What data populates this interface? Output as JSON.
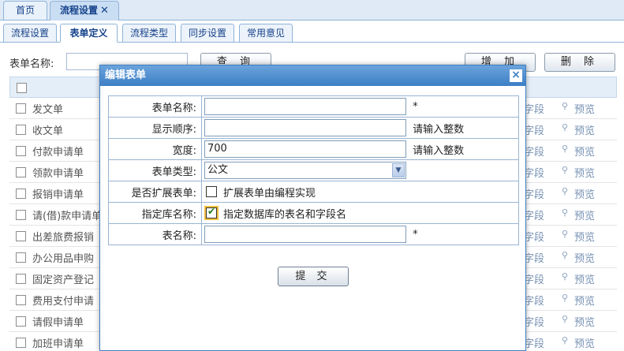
{
  "top_tabs": [
    {
      "label": "首页"
    },
    {
      "label": "流程设置",
      "close": "✕"
    }
  ],
  "sub_tabs": [
    {
      "label": "流程设置"
    },
    {
      "label": "表单定义"
    },
    {
      "label": "流程类型"
    },
    {
      "label": "同步设置"
    },
    {
      "label": "常用意见"
    }
  ],
  "toolbar": {
    "name_label": "表单名称:",
    "query_label": "查 询",
    "add_label": "增 加",
    "delete_label": "删 除"
  },
  "table": {
    "field_text": "字段",
    "preview_text": "预览",
    "preview_icon": "magnifier-icon",
    "rows": [
      {
        "name": "发文单"
      },
      {
        "name": "收文单"
      },
      {
        "name": "付款申请单"
      },
      {
        "name": "领款申请单"
      },
      {
        "name": "报销申请单"
      },
      {
        "name": "请(借)款申请单"
      },
      {
        "name": "出差旅费报销"
      },
      {
        "name": "办公用品申购"
      },
      {
        "name": "固定资产登记"
      },
      {
        "name": "费用支付申请"
      },
      {
        "name": "请假申请单"
      },
      {
        "name": "加班申请单"
      }
    ]
  },
  "dialog": {
    "title": "编辑表单",
    "close_icon": "close-icon",
    "fields": {
      "form_name_label": "表单名称:",
      "form_name_value": "",
      "required_mark": "*",
      "order_label": "显示顺序:",
      "order_value": "",
      "order_hint": "请输入整数",
      "width_label": "宽度:",
      "width_value": "700",
      "width_hint": "请输入整数",
      "type_label": "表单类型:",
      "type_value": "公文",
      "extend_label": "是否扩展表单:",
      "extend_checked": false,
      "extend_text": "扩展表单由编程实现",
      "db_label": "指定库名称:",
      "db_checked": true,
      "db_text": "指定数据库的表名和字段名",
      "table_name_label": "表名称:",
      "table_name_value": "",
      "table_required_mark": "*"
    },
    "submit_label": "提 交"
  },
  "colors": {
    "accent": "#3d7fc5",
    "tab_text": "#15428b",
    "link": "#7892b4"
  }
}
